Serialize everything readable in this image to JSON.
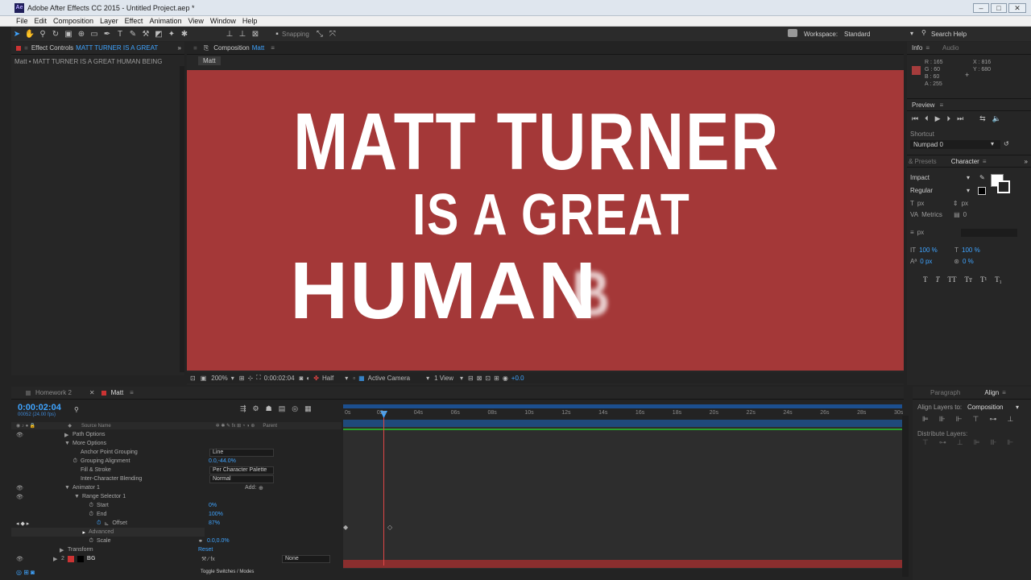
{
  "app": {
    "title": "Adobe After Effects CC 2015 - Untitled Project.aep *",
    "icon_label": "Ae"
  },
  "menu": [
    "File",
    "Edit",
    "Composition",
    "Layer",
    "Effect",
    "Animation",
    "View",
    "Window",
    "Help"
  ],
  "toolbar": {
    "snapping_label": "Snapping",
    "workspace_label": "Workspace:",
    "workspace_value": "Standard",
    "search_placeholder": "Search Help"
  },
  "effect_controls": {
    "tab_label": "Effect Controls",
    "tab_layer": "MATT TURNER IS A GREAT",
    "breadcrumb": "Matt • MATT TURNER IS A GREAT HUMAN BEING"
  },
  "composition": {
    "tab_label": "Composition",
    "tab_name": "Matt",
    "sub_tab": "Matt",
    "text_line1": "MATT TURNER",
    "text_line2": "IS A GREAT",
    "text_line3": "HUMAN",
    "text_line3_fade": "B",
    "background_color": "#a43838",
    "zoom": "200%",
    "timecode": "0:00:02:04",
    "resolution": "Half",
    "camera": "Active Camera",
    "views": "1 View",
    "exposure": "+0.0"
  },
  "info": {
    "tab_info": "Info",
    "tab_audio": "Audio",
    "r": "R : 165",
    "g": "G : 60",
    "b": "B : 60",
    "a": "A : 255",
    "x": "X : 816",
    "y": "Y : 680",
    "swatch_color": "#a53c3c"
  },
  "preview": {
    "tab_label": "Preview",
    "shortcut_label": "Shortcut",
    "shortcut_value": "Numpad 0"
  },
  "character": {
    "tab_effects": "& Presets",
    "tab_label": "Character",
    "font": "Impact",
    "style": "Regular",
    "size": "px",
    "leading": "px",
    "kerning": "Metrics",
    "tracking": "0",
    "stroke": "px",
    "vscale": "100 %",
    "hscale": "100 %",
    "baseline": "0 px",
    "tsume": "0 %",
    "styles": [
      "T",
      "T",
      "TT",
      "Tт",
      "T¹",
      "T₁"
    ]
  },
  "paragraph": {
    "tab_paragraph": "Paragraph",
    "tab_align": "Align",
    "align_layers_label": "Align Layers to:",
    "align_layers_value": "Composition",
    "distribute_label": "Distribute Layers:"
  },
  "timeline": {
    "tabs": [
      "Homework 2",
      "Matt"
    ],
    "timecode": "0:00:02:04",
    "fps": "00052 (24.00 fps)",
    "col_source": "Source Name",
    "col_parent": "Parent",
    "ruler": [
      "0s",
      "02s",
      "04s",
      "06s",
      "08s",
      "10s",
      "12s",
      "14s",
      "16s",
      "18s",
      "20s",
      "22s",
      "24s",
      "26s",
      "28s",
      "30s"
    ],
    "rows": [
      {
        "label": "Path Options",
        "indent": 1
      },
      {
        "label": "More Options",
        "indent": 1
      },
      {
        "label": "Anchor Point Grouping",
        "indent": 2,
        "dropdown": "Line"
      },
      {
        "label": "Grouping Alignment",
        "indent": 2,
        "value": "0.0,-44.0%"
      },
      {
        "label": "Fill & Stroke",
        "indent": 2,
        "dropdown": "Per Character Palette"
      },
      {
        "label": "Inter-Character Blending",
        "indent": 2,
        "dropdown": "Normal"
      },
      {
        "label": "Animator 1",
        "indent": 1,
        "add": "Add:"
      },
      {
        "label": "Range Selector 1",
        "indent": 2
      },
      {
        "label": "Start",
        "indent": 3,
        "value": "0%"
      },
      {
        "label": "End",
        "indent": 3,
        "value": "100%"
      },
      {
        "label": "Offset",
        "indent": 3,
        "value": "87%"
      },
      {
        "label": "Advanced",
        "indent": 3
      },
      {
        "label": "Scale",
        "indent": 2,
        "value": "0.0,0.0%"
      },
      {
        "label": "Transform",
        "indent": 0,
        "value": "Reset"
      }
    ],
    "bg_layer": {
      "num": "2",
      "name": "BG",
      "parent": "None"
    },
    "toggle_label": "Toggle Switches / Modes"
  }
}
